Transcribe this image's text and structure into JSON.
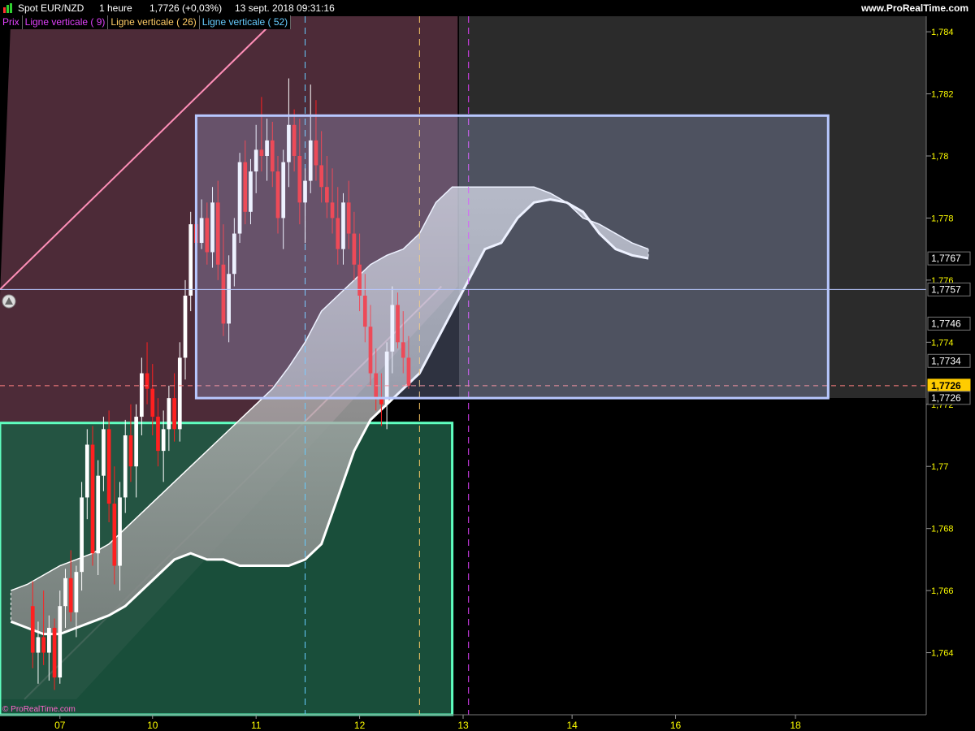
{
  "header": {
    "symbol": "Spot EUR/NZD",
    "timeframe": "1 heure",
    "last_change": "1,7726 (+0,03%)",
    "datetime": "13 sept. 2018 09:31:16",
    "site": "www.ProRealTime.com"
  },
  "legend": [
    {
      "label": "Prix",
      "color": "#e040fb"
    },
    {
      "label": "Ligne verticale ( 9)",
      "color": "#e040fb"
    },
    {
      "label": "Ligne verticale ( 26)",
      "color": "#ffcc66"
    },
    {
      "label": "Ligne verticale ( 52)",
      "color": "#66ccff"
    }
  ],
  "watermark": "© ProRealTime.com",
  "colors": {
    "background": "#000000",
    "axis_text": "#ffff00",
    "bull_candle": "#ffffff",
    "bear_candle": "#ff2020",
    "cloud": "#bbbbbb",
    "pink_zone": "#ff8fb8",
    "green_zone": "#1d5c44",
    "green_border": "#5fffc0",
    "blue_box": "#b8c8ff",
    "vline_9": "#e040fb",
    "vline_26": "#ffcc66",
    "vline_52": "#66ccff"
  },
  "chart_data": {
    "type": "candlestick",
    "title": "",
    "xlabel": "",
    "ylabel": "",
    "ylim": [
      1.762,
      1.7845
    ],
    "y_ticks": [
      "1,764",
      "1,766",
      "1,768",
      "1,77",
      "1,772",
      "1,774",
      "1,776",
      "1,778",
      "1,78",
      "1,782",
      "1,784"
    ],
    "y_tick_values": [
      1.764,
      1.766,
      1.768,
      1.77,
      1.772,
      1.774,
      1.776,
      1.778,
      1.78,
      1.782,
      1.784
    ],
    "x_ticks": [
      "07",
      "10",
      "11",
      "12",
      "13",
      "14",
      "16",
      "18"
    ],
    "x_tick_index": [
      5,
      22,
      41,
      60,
      79,
      99,
      118,
      140
    ],
    "xlim": [
      -6,
      164
    ],
    "price_labels": [
      {
        "text": "1,7767",
        "value": 1.7767,
        "style": "plain"
      },
      {
        "text": "1,7757",
        "value": 1.7757,
        "style": "plain"
      },
      {
        "text": "1,7746",
        "value": 1.7746,
        "style": "plain"
      },
      {
        "text": "1,7734",
        "value": 1.7734,
        "style": "plain"
      },
      {
        "text": "1,7726",
        "value": 1.7726,
        "style": "highlight"
      },
      {
        "text": "1,7726",
        "value": 1.7726,
        "style": "plain2"
      }
    ],
    "horizontal_line": 1.7757,
    "current_price": 1.7726,
    "vertical_lines": [
      {
        "name": "Ligne verticale ( 9)",
        "index": 80
      },
      {
        "name": "Ligne verticale ( 26)",
        "index": 71
      },
      {
        "name": "Ligne verticale ( 52)",
        "index": 50
      }
    ],
    "zones": {
      "pink_band": {
        "x0": -6,
        "x1": 78,
        "y_top": 1.7845
      },
      "green_rect": {
        "x0": -6,
        "x1": 77,
        "y_top": 1.7714,
        "y_bottom": 1.762
      },
      "blue_rect": {
        "x0": 30,
        "x1": 146,
        "y_top": 1.7813,
        "y_bottom": 1.7722
      }
    },
    "candles": [
      [
        1.7655,
        1.7663,
        1.7635,
        1.764
      ],
      [
        1.764,
        1.765,
        1.763,
        1.7645
      ],
      [
        1.7645,
        1.766,
        1.7636,
        1.764
      ],
      [
        1.764,
        1.7652,
        1.7631,
        1.7648
      ],
      [
        1.7648,
        1.7651,
        1.7628,
        1.7632
      ],
      [
        1.7632,
        1.766,
        1.763,
        1.7655
      ],
      [
        1.7655,
        1.7667,
        1.7648,
        1.7664
      ],
      [
        1.7664,
        1.7673,
        1.765,
        1.7653
      ],
      [
        1.7653,
        1.7668,
        1.7645,
        1.7666
      ],
      [
        1.7666,
        1.7695,
        1.766,
        1.769
      ],
      [
        1.769,
        1.7712,
        1.7683,
        1.7707
      ],
      [
        1.7707,
        1.7713,
        1.7668,
        1.7672
      ],
      [
        1.7672,
        1.7702,
        1.7665,
        1.7697
      ],
      [
        1.7697,
        1.7716,
        1.7692,
        1.7712
      ],
      [
        1.7712,
        1.7718,
        1.7682,
        1.7688
      ],
      [
        1.7688,
        1.77,
        1.7662,
        1.7668
      ],
      [
        1.7668,
        1.7695,
        1.766,
        1.769
      ],
      [
        1.769,
        1.7715,
        1.7685,
        1.771
      ],
      [
        1.771,
        1.772,
        1.7695,
        1.77
      ],
      [
        1.77,
        1.772,
        1.769,
        1.7716
      ],
      [
        1.7716,
        1.7735,
        1.771,
        1.773
      ],
      [
        1.773,
        1.774,
        1.772,
        1.7725
      ],
      [
        1.7725,
        1.7733,
        1.771,
        1.7716
      ],
      [
        1.7716,
        1.7722,
        1.77,
        1.7705
      ],
      [
        1.7705,
        1.7718,
        1.7695,
        1.7712
      ],
      [
        1.7712,
        1.7726,
        1.7705,
        1.7722
      ],
      [
        1.7722,
        1.773,
        1.7708,
        1.7712
      ],
      [
        1.7712,
        1.774,
        1.7708,
        1.7735
      ],
      [
        1.7735,
        1.776,
        1.7728,
        1.7755
      ],
      [
        1.7755,
        1.7782,
        1.775,
        1.7778
      ],
      [
        1.7778,
        1.779,
        1.7765,
        1.7772
      ],
      [
        1.7772,
        1.7786,
        1.777,
        1.778
      ],
      [
        1.778,
        1.7785,
        1.7765,
        1.7769
      ],
      [
        1.7769,
        1.779,
        1.7764,
        1.7785
      ],
      [
        1.7785,
        1.7792,
        1.776,
        1.7765
      ],
      [
        1.7765,
        1.7778,
        1.7742,
        1.7746
      ],
      [
        1.7746,
        1.7768,
        1.774,
        1.7762
      ],
      [
        1.7762,
        1.778,
        1.7758,
        1.7775
      ],
      [
        1.7775,
        1.7801,
        1.7772,
        1.7798
      ],
      [
        1.7798,
        1.7805,
        1.7778,
        1.7782
      ],
      [
        1.7782,
        1.7799,
        1.7778,
        1.7795
      ],
      [
        1.7795,
        1.781,
        1.7788,
        1.7802
      ],
      [
        1.7802,
        1.7819,
        1.7795,
        1.78
      ],
      [
        1.78,
        1.7812,
        1.7792,
        1.7805
      ],
      [
        1.7805,
        1.7811,
        1.779,
        1.7795
      ],
      [
        1.7795,
        1.78,
        1.7775,
        1.778
      ],
      [
        1.778,
        1.7802,
        1.777,
        1.7798
      ],
      [
        1.7798,
        1.7825,
        1.779,
        1.781
      ],
      [
        1.781,
        1.7815,
        1.7795,
        1.78
      ],
      [
        1.78,
        1.7812,
        1.7778,
        1.7785
      ],
      [
        1.7785,
        1.7796,
        1.7772,
        1.7792
      ],
      [
        1.7792,
        1.7823,
        1.7788,
        1.7805
      ],
      [
        1.7805,
        1.7818,
        1.7792,
        1.7797
      ],
      [
        1.7797,
        1.7808,
        1.7785,
        1.779
      ],
      [
        1.779,
        1.78,
        1.778,
        1.7785
      ],
      [
        1.7785,
        1.7796,
        1.7775,
        1.778
      ],
      [
        1.778,
        1.779,
        1.7765,
        1.777
      ],
      [
        1.777,
        1.7788,
        1.7765,
        1.7785
      ],
      [
        1.7785,
        1.7792,
        1.777,
        1.7775
      ],
      [
        1.7775,
        1.7782,
        1.776,
        1.7765
      ],
      [
        1.7765,
        1.7775,
        1.775,
        1.7755
      ],
      [
        1.7755,
        1.7762,
        1.774,
        1.7745
      ],
      [
        1.7745,
        1.7752,
        1.7726,
        1.773
      ],
      [
        1.773,
        1.7738,
        1.7718,
        1.7722
      ],
      [
        1.7722,
        1.773,
        1.7713,
        1.772
      ],
      [
        1.772,
        1.774,
        1.7712,
        1.7737
      ],
      [
        1.7737,
        1.7758,
        1.773,
        1.7752
      ],
      [
        1.7752,
        1.7756,
        1.7738,
        1.774
      ],
      [
        1.774,
        1.775,
        1.773,
        1.7735
      ],
      [
        1.7735,
        1.7742,
        1.7725,
        1.7726
      ]
    ],
    "series": [
      {
        "values": [
          1.766,
          1.7662,
          1.7665,
          1.7668,
          1.767,
          1.7672,
          1.7675,
          1.768,
          1.7685,
          1.769,
          1.7695,
          1.77,
          1.7705,
          1.771,
          1.7715,
          1.772,
          1.7725,
          1.7732,
          1.774,
          1.775,
          1.7755,
          1.776,
          1.7765,
          1.7768,
          1.777,
          1.7775,
          1.7785,
          1.779,
          1.779,
          1.779,
          1.779,
          1.779,
          1.779,
          1.7788,
          1.7785,
          1.778,
          1.7778,
          1.7775,
          1.7772,
          1.777
        ]
      },
      {
        "values": [
          1.765,
          1.7648,
          1.7646,
          1.7646,
          1.7648,
          1.765,
          1.7652,
          1.7655,
          1.766,
          1.7665,
          1.767,
          1.7672,
          1.767,
          1.767,
          1.7668,
          1.7668,
          1.7668,
          1.7668,
          1.767,
          1.7675,
          1.769,
          1.7705,
          1.7715,
          1.772,
          1.7725,
          1.773,
          1.774,
          1.775,
          1.776,
          1.777,
          1.7772,
          1.778,
          1.7785,
          1.7786,
          1.7785,
          1.7782,
          1.7775,
          1.777,
          1.7768,
          1.7767
        ]
      }
    ]
  }
}
